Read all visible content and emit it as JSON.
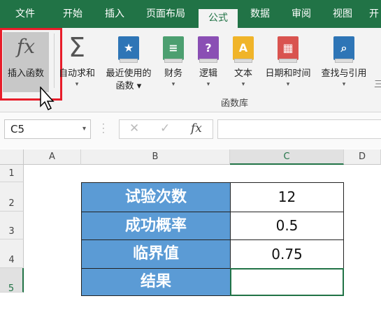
{
  "tabs": [
    "文件",
    "开始",
    "插入",
    "页面布局",
    "公式",
    "数据",
    "审阅",
    "视图",
    "开"
  ],
  "ribbon": {
    "insert_function": "插入函数",
    "autosum": "自动求和",
    "recent_line1": "最近使用的",
    "recent_line2": "函数",
    "financial": "财务",
    "logical": "逻辑",
    "text": "文本",
    "datetime": "日期和时间",
    "lookup": "查找与引用",
    "group_label": "函数库",
    "fx_glyph": "fx",
    "sigma_glyph": "Σ"
  },
  "formula_bar": {
    "name_box": "C5",
    "cancel": "✕",
    "enter": "✓",
    "fx": "fx",
    "content": ""
  },
  "columns": [
    "A",
    "B",
    "C",
    "D"
  ],
  "rows": [
    "1",
    "2",
    "3",
    "4",
    "5"
  ],
  "table": [
    {
      "label": "试验次数",
      "value": "12"
    },
    {
      "label": "成功概率",
      "value": "0.5"
    },
    {
      "label": "临界值",
      "value": "0.75"
    },
    {
      "label": "结果",
      "value": ""
    }
  ],
  "colors": {
    "excel_green": "#217346",
    "label_fill": "#5b9bd5",
    "highlight_red": "#e81d2a"
  }
}
